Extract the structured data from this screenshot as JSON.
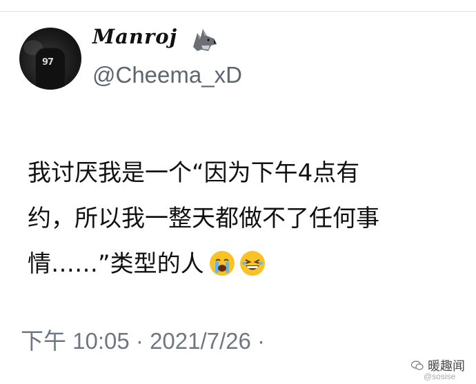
{
  "author": {
    "display_name": "Manroj",
    "display_name_icon": "wolf-icon",
    "handle": "@Cheema_xD",
    "avatar_jersey_text": "97"
  },
  "tweet": {
    "lines": [
      "我讨厌我是一个“因为下午4点有",
      "约，所以我一整天都做不了任何事",
      "情……”类型的人"
    ],
    "emojis": [
      "crying-face-icon",
      "laughing-face-icon"
    ]
  },
  "meta": {
    "timestamp": "下午 10:05 · 2021/7/26 ·"
  },
  "watermark": {
    "text": "暖趣闻",
    "sub": "@sosise",
    "icon": "wechat-icon"
  },
  "colors": {
    "text": "#111111",
    "secondary": "#6e7781",
    "emoji_yellow": "#f7c326"
  }
}
